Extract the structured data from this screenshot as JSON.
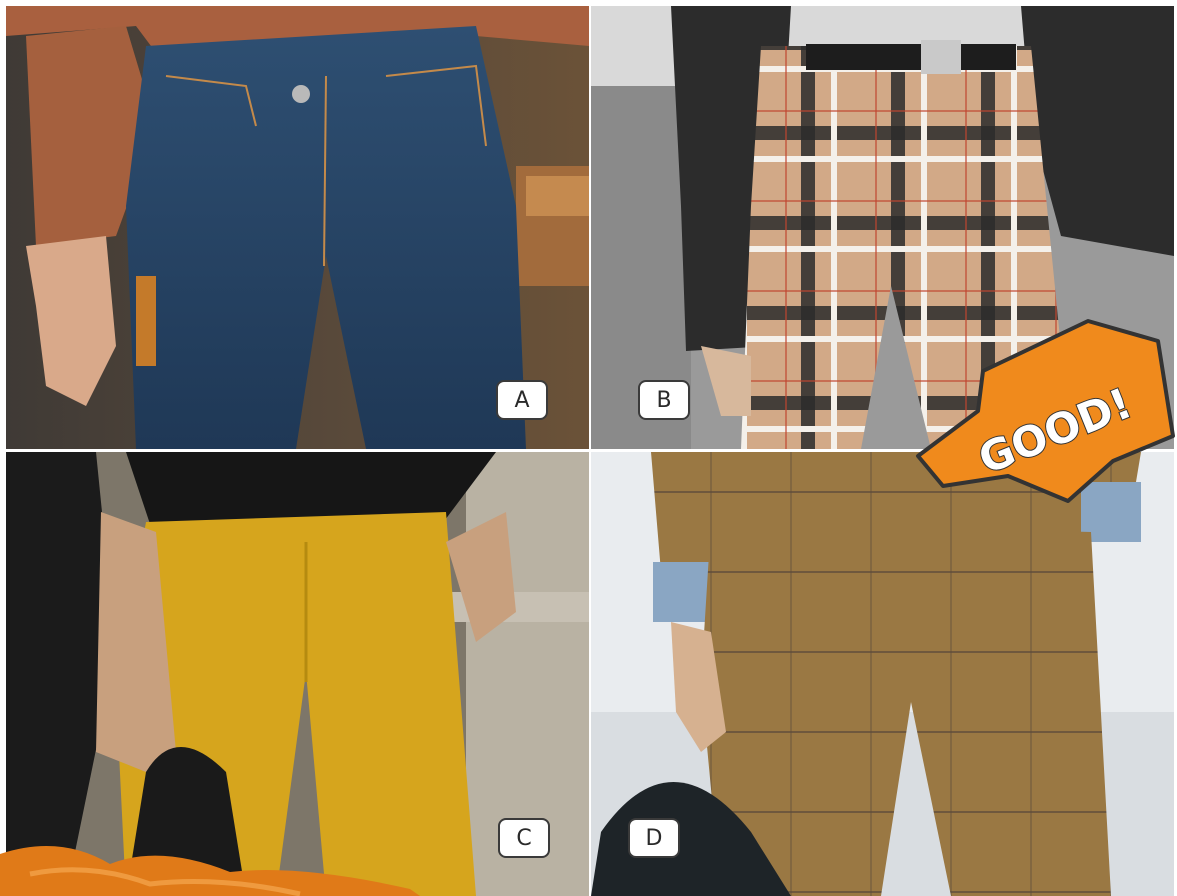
{
  "panels": [
    {
      "id": "A",
      "label": "A",
      "description_colors": {
        "main": "#2a4664",
        "accent": "#a9603f"
      }
    },
    {
      "id": "B",
      "label": "B",
      "description_colors": {
        "main": "#c9a27e",
        "accent": "#2b2b2b"
      }
    },
    {
      "id": "C",
      "label": "C",
      "description_colors": {
        "main": "#d6a51d",
        "accent": "#1a1a1a"
      }
    },
    {
      "id": "D",
      "label": "D",
      "description_colors": {
        "main": "#9a7843",
        "accent": "#5a4a3a"
      }
    }
  ],
  "badge": {
    "text": "GOOD!",
    "color": "#f08a1c"
  },
  "colors": {
    "badge_orange": "#f08a1c",
    "badge_border": "#333333"
  }
}
